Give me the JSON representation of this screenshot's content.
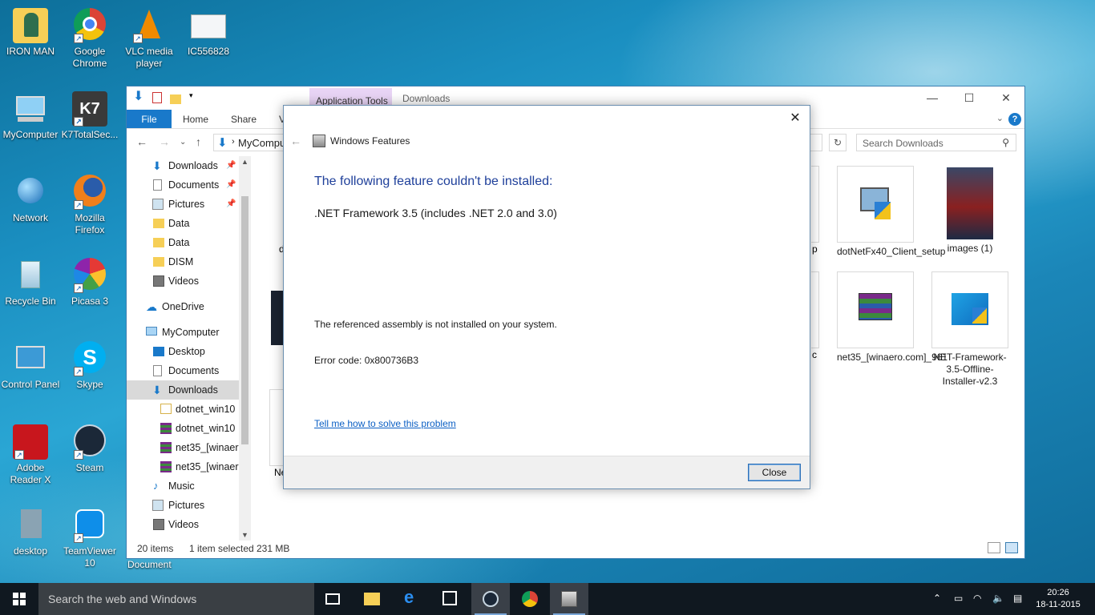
{
  "desktop": {
    "icons": [
      {
        "label": "IRON MAN"
      },
      {
        "label": "Google Chrome"
      },
      {
        "label": "VLC media player"
      },
      {
        "label": "IC556828"
      },
      {
        "label": "MyComputer"
      },
      {
        "label": "K7TotalSec..."
      },
      {
        "label": "Network"
      },
      {
        "label": "Mozilla Firefox"
      },
      {
        "label": "Recycle Bin"
      },
      {
        "label": "Picasa 3"
      },
      {
        "label": "Control Panel"
      },
      {
        "label": "Skype"
      },
      {
        "label": "Adobe Reader X"
      },
      {
        "label": "Steam"
      },
      {
        "label": "desktop"
      },
      {
        "label": "TeamViewer 10"
      }
    ],
    "partial_label": "Document"
  },
  "explorer": {
    "context_tab": "Application Tools",
    "title": "Downloads",
    "ribbon_tabs": [
      "File",
      "Home",
      "Share",
      "Vi"
    ],
    "address": "MyComputer",
    "search_placeholder": "Search Downloads",
    "nav": [
      {
        "label": "Downloads",
        "pinned": true
      },
      {
        "label": "Documents",
        "pinned": true
      },
      {
        "label": "Pictures",
        "pinned": true
      },
      {
        "label": "Data"
      },
      {
        "label": "Data"
      },
      {
        "label": "DISM"
      },
      {
        "label": "Videos"
      },
      {
        "label": "OneDrive"
      },
      {
        "label": "MyComputer"
      },
      {
        "label": "Desktop"
      },
      {
        "label": "Documents"
      },
      {
        "label": "Downloads",
        "selected": true
      },
      {
        "label": "dotnet_win10"
      },
      {
        "label": "dotnet_win10"
      },
      {
        "label": "net35_[winaero"
      },
      {
        "label": "net35_[winaero"
      },
      {
        "label": "Music"
      },
      {
        "label": "Pictures"
      },
      {
        "label": "Videos"
      }
    ],
    "files": [
      {
        "label": "dotNetFx40_Client_setup"
      },
      {
        "label": "images (1)"
      },
      {
        "label": "net35_[winaero.com]_961"
      },
      {
        "label": "NET-Framework-3.5-Offline-Installer-v2.3"
      }
    ],
    "partial_labels": {
      "a": "d",
      "b": "p",
      "c": "c",
      "d": "Ne"
    },
    "status": {
      "items": "20 items",
      "selected": "1 item selected",
      "size": "231 MB"
    }
  },
  "dialog": {
    "title": "Windows Features",
    "heading": "The following feature couldn't be installed:",
    "feature": ".NET Framework 3.5 (includes .NET 2.0 and 3.0)",
    "message": "The referenced assembly is not installed on your system.",
    "error_code": "Error code: 0x800736B3",
    "link": "Tell me how to solve this problem",
    "close_button": "Close"
  },
  "taskbar": {
    "search_placeholder": "Search the web and Windows",
    "time": "20:26",
    "date": "18-11-2015"
  }
}
